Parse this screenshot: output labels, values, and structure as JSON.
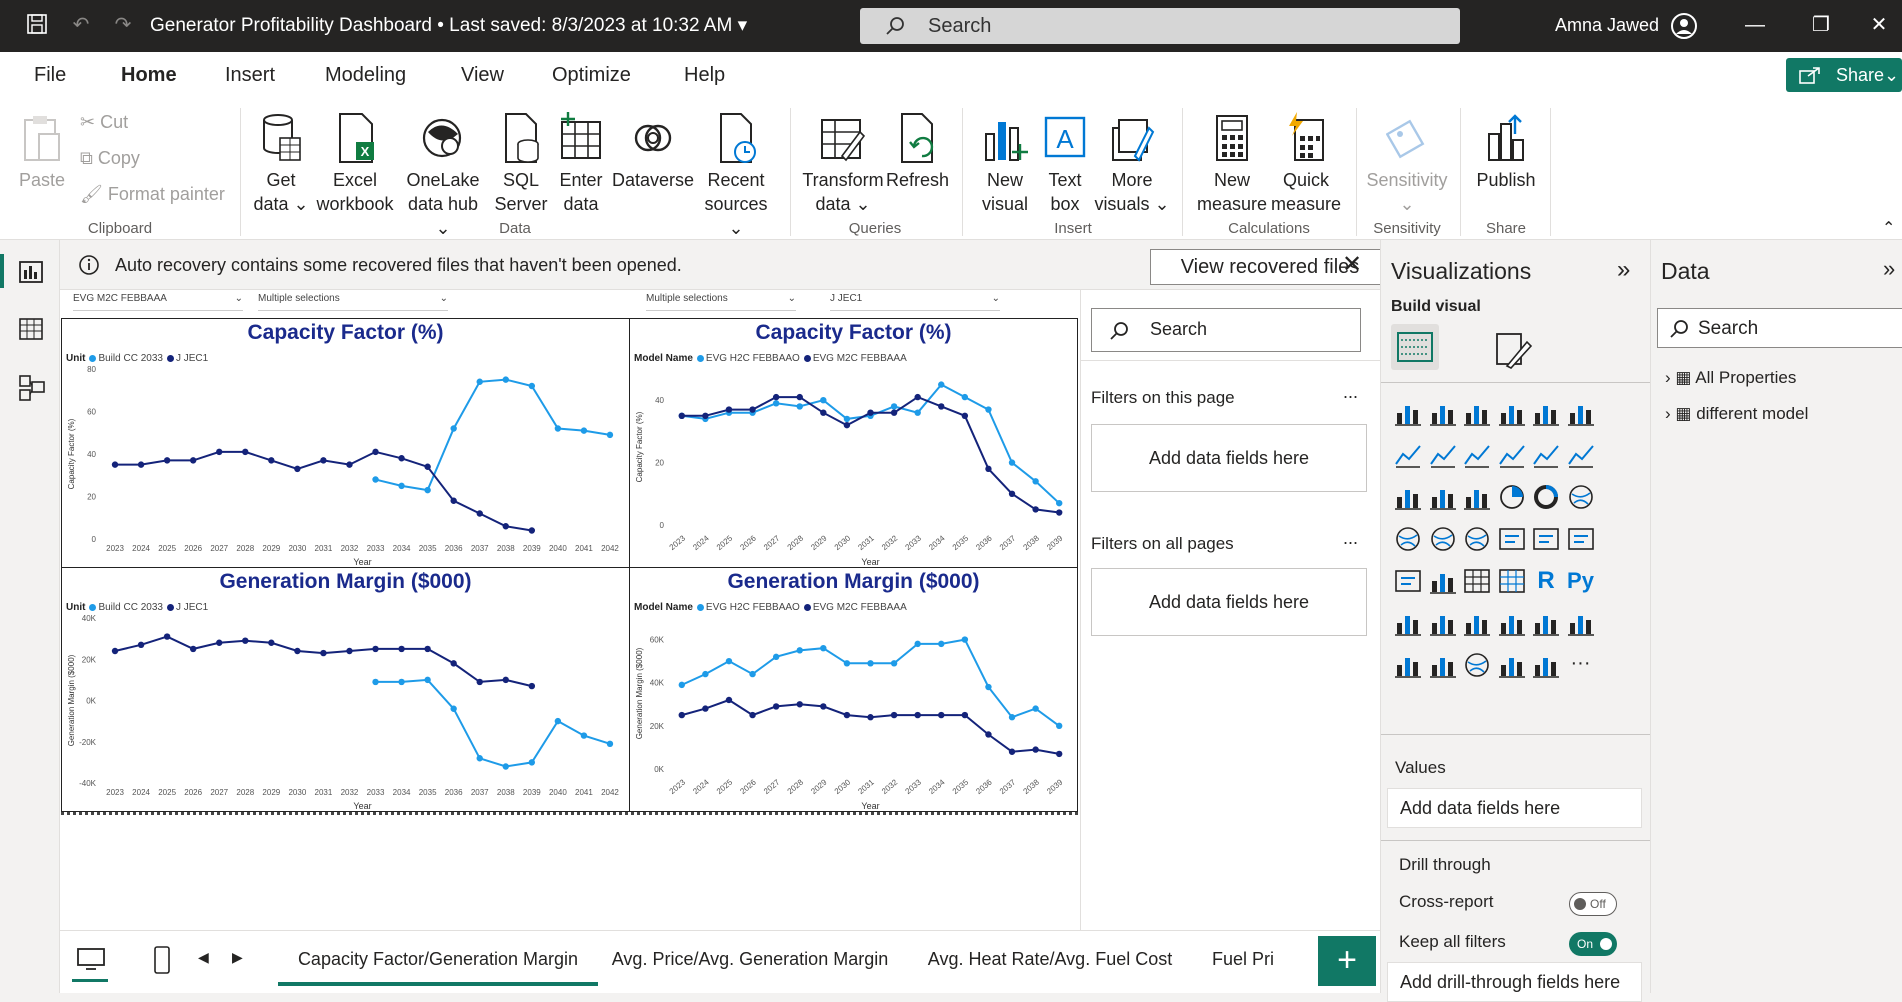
{
  "titlebar": {
    "title": "Generator Profitability Dashboard • Last saved: 8/3/2023 at 10:32 AM",
    "search": "Search",
    "user": "Amna Jawed"
  },
  "menu": {
    "items": [
      "File",
      "Home",
      "Insert",
      "Modeling",
      "View",
      "Optimize",
      "Help"
    ],
    "active": "Home",
    "share": "Share"
  },
  "ribbon": {
    "clipboard": {
      "paste": "Paste",
      "cut": "Cut",
      "copy": "Copy",
      "format_painter": "Format painter",
      "label": "Clipboard"
    },
    "data": {
      "get_data": [
        "Get",
        "data ⌄"
      ],
      "excel": [
        "Excel",
        "workbook"
      ],
      "onelake": [
        "OneLake",
        "data hub ⌄"
      ],
      "sql": [
        "SQL",
        "Server"
      ],
      "enter": [
        "Enter",
        "data"
      ],
      "dataverse": [
        "Dataverse",
        ""
      ],
      "recent": [
        "Recent",
        "sources ⌄"
      ],
      "label": "Data"
    },
    "queries": {
      "transform": [
        "Transform",
        "data ⌄"
      ],
      "refresh": [
        "Refresh",
        ""
      ],
      "label": "Queries"
    },
    "insert": {
      "new_visual": [
        "New",
        "visual"
      ],
      "text_box": [
        "Text",
        "box"
      ],
      "more_visuals": [
        "More",
        "visuals ⌄"
      ],
      "label": "Insert"
    },
    "calculations": {
      "new_measure": [
        "New",
        "measure"
      ],
      "quick_measure": [
        "Quick",
        "measure"
      ],
      "label": "Calculations"
    },
    "sensitivity": {
      "btn": [
        "Sensitivity",
        "⌄"
      ],
      "label": "Sensitivity"
    },
    "share": {
      "publish": [
        "Publish",
        ""
      ],
      "label": "Share"
    }
  },
  "notification": {
    "text": "Auto recovery contains some recovered files that haven't been opened.",
    "button": "View recovered files"
  },
  "slicers": [
    "EVG M2C FEBBAAA",
    "Multiple selections",
    "Multiple selections",
    "J JEC1"
  ],
  "chart_data": [
    {
      "type": "line",
      "title": "Capacity Factor (%)",
      "legend_title": "Unit",
      "xlabel": "Year",
      "ylabel": "Capacity Factor (%)",
      "ylim": [
        0,
        80
      ],
      "yticks": [
        "0",
        "20",
        "40",
        "60",
        "80"
      ],
      "x": [
        "2023",
        "2024",
        "2025",
        "2026",
        "2027",
        "2028",
        "2029",
        "2030",
        "2031",
        "2032",
        "2033",
        "2034",
        "2035",
        "2036",
        "2037",
        "2038",
        "2039",
        "2040",
        "2041",
        "2042"
      ],
      "series": [
        {
          "name": "Build CC 2033",
          "color": "#1e9be8",
          "values": [
            null,
            null,
            null,
            null,
            null,
            null,
            null,
            null,
            null,
            null,
            28,
            25,
            23,
            52,
            74,
            75,
            72,
            52,
            51,
            49
          ]
        },
        {
          "name": "J JEC1",
          "color": "#14237a",
          "values": [
            35,
            35,
            37,
            37,
            41,
            41,
            37,
            33,
            37,
            35,
            41,
            38,
            34,
            18,
            12,
            6,
            4,
            null,
            null,
            null
          ]
        }
      ]
    },
    {
      "type": "line",
      "title": "Capacity Factor (%)",
      "legend_title": "Model Name",
      "xlabel": "Year",
      "ylabel": "Capacity Factor (%)",
      "ylim": [
        0,
        50
      ],
      "yticks": [
        "0",
        "20",
        "40"
      ],
      "x": [
        "2023",
        "2024",
        "2025",
        "2026",
        "2027",
        "2028",
        "2029",
        "2030",
        "2031",
        "2032",
        "2033",
        "2034",
        "2035",
        "2036",
        "2037",
        "2038",
        "2039"
      ],
      "series": [
        {
          "name": "EVG H2C FEBBAAO",
          "color": "#1e9be8",
          "values": [
            35,
            34,
            36,
            36,
            39,
            38,
            40,
            34,
            35,
            38,
            36,
            45,
            41,
            37,
            20,
            14,
            7
          ]
        },
        {
          "name": "EVG M2C FEBBAAA",
          "color": "#14237a",
          "values": [
            35,
            35,
            37,
            37,
            41,
            41,
            36,
            32,
            36,
            36,
            41,
            38,
            35,
            18,
            10,
            5,
            4
          ]
        }
      ]
    },
    {
      "type": "line",
      "title": "Generation Margin ($000)",
      "legend_title": "Unit",
      "xlabel": "Year",
      "ylabel": "Generation Margin ($000)",
      "ylim": [
        -40,
        40
      ],
      "yticks": [
        "-40K",
        "-20K",
        "0K",
        "20K",
        "40K"
      ],
      "x": [
        "2023",
        "2024",
        "2025",
        "2026",
        "2027",
        "2028",
        "2029",
        "2030",
        "2031",
        "2032",
        "2033",
        "2034",
        "2035",
        "2036",
        "2037",
        "2038",
        "2039",
        "2040",
        "2041",
        "2042"
      ],
      "series": [
        {
          "name": "Build CC 2033",
          "color": "#1e9be8",
          "values": [
            null,
            null,
            null,
            null,
            null,
            null,
            null,
            null,
            null,
            null,
            9,
            9,
            10,
            -4,
            -28,
            -32,
            -30,
            -10,
            -17,
            -21
          ]
        },
        {
          "name": "J JEC1",
          "color": "#14237a",
          "values": [
            24,
            27,
            31,
            25,
            28,
            29,
            28,
            24,
            23,
            24,
            25,
            25,
            25,
            18,
            9,
            10,
            7,
            null,
            null,
            null
          ]
        }
      ]
    },
    {
      "type": "line",
      "title": "Generation Margin ($000)",
      "legend_title": "Model Name",
      "xlabel": "Year",
      "ylabel": "Generation Margin ($000)",
      "ylim": [
        0,
        70
      ],
      "yticks": [
        "0K",
        "20K",
        "40K",
        "60K"
      ],
      "x": [
        "2023",
        "2024",
        "2025",
        "2026",
        "2027",
        "2028",
        "2029",
        "2030",
        "2031",
        "2032",
        "2033",
        "2034",
        "2035",
        "2036",
        "2037",
        "2038",
        "2039"
      ],
      "series": [
        {
          "name": "EVG H2C FEBBAAO",
          "color": "#1e9be8",
          "values": [
            39,
            44,
            50,
            44,
            52,
            55,
            56,
            49,
            49,
            49,
            58,
            58,
            60,
            38,
            24,
            28,
            20
          ]
        },
        {
          "name": "EVG M2C FEBBAAA",
          "color": "#14237a",
          "values": [
            25,
            28,
            32,
            25,
            29,
            30,
            29,
            25,
            24,
            25,
            25,
            25,
            25,
            16,
            8,
            9,
            7
          ]
        }
      ]
    }
  ],
  "filters": {
    "search": "Search",
    "this_page": "Filters on this page",
    "all_pages": "Filters on all pages",
    "add": "Add data fields here",
    "more": "..."
  },
  "visualizations": {
    "title": "Visualizations",
    "build": "Build visual",
    "values": "Values",
    "add_values": "Add data fields here",
    "drill": "Drill through",
    "cross_report": "Cross-report",
    "cross_state": "Off",
    "keep_filters": "Keep all filters",
    "keep_state": "On",
    "add_drill": "Add drill-through fields here",
    "r_label": "R",
    "py_label": "Py",
    "more": "···"
  },
  "datapane": {
    "title": "Data",
    "search": "Search",
    "items": [
      "All Properties",
      "different model"
    ]
  },
  "tabs": {
    "items": [
      "Capacity Factor/Generation Margin",
      "Avg. Price/Avg. Generation Margin",
      "Avg. Heat Rate/Avg. Fuel Cost",
      "Fuel Pri"
    ],
    "active": 0,
    "add": "+"
  },
  "colors": {
    "accent": "#117865",
    "titlebar": "#252423",
    "series_light": "#1e9be8",
    "series_dark": "#14237a",
    "title_blue": "#1a2a8c"
  }
}
